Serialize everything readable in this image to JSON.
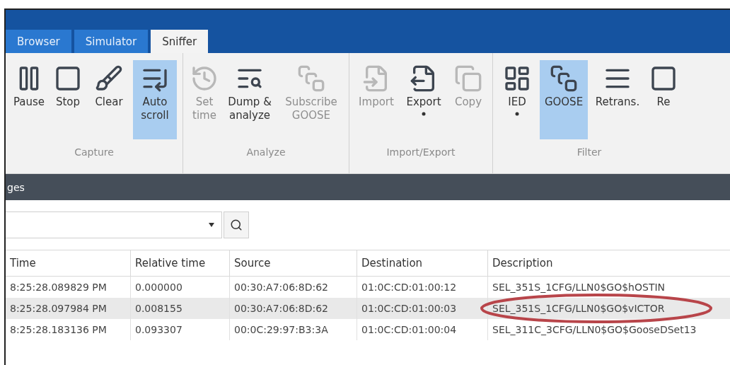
{
  "tabs": [
    {
      "label": "Browser",
      "selected": false
    },
    {
      "label": "Simulator",
      "selected": false
    },
    {
      "label": "Sniffer",
      "selected": true
    }
  ],
  "ribbon": [
    {
      "label": "Capture",
      "buttons": [
        {
          "label": "Pause",
          "disabled": false,
          "selected": false,
          "dropdown": false
        },
        {
          "label": "Stop",
          "disabled": false,
          "selected": false,
          "dropdown": false
        },
        {
          "label": "Clear",
          "disabled": false,
          "selected": false,
          "dropdown": false
        },
        {
          "label": "Auto\nscroll",
          "disabled": false,
          "selected": true,
          "dropdown": false
        }
      ]
    },
    {
      "label": "Analyze",
      "buttons": [
        {
          "label": "Set\ntime",
          "disabled": true,
          "selected": false,
          "dropdown": false
        },
        {
          "label": "Dump &\nanalyze",
          "disabled": false,
          "selected": false,
          "dropdown": false
        },
        {
          "label": "Subscribe\nGOOSE",
          "disabled": true,
          "selected": false,
          "dropdown": false
        }
      ]
    },
    {
      "label": "Import/Export",
      "buttons": [
        {
          "label": "Import",
          "disabled": true,
          "selected": false,
          "dropdown": false
        },
        {
          "label": "Export",
          "disabled": false,
          "selected": false,
          "dropdown": true
        },
        {
          "label": "Copy",
          "disabled": true,
          "selected": false,
          "dropdown": false
        }
      ]
    },
    {
      "label": "Filter",
      "buttons": [
        {
          "label": "IED",
          "disabled": false,
          "selected": false,
          "dropdown": true
        },
        {
          "label": "GOOSE",
          "disabled": false,
          "selected": true,
          "dropdown": false
        },
        {
          "label": "Retrans.",
          "disabled": false,
          "selected": false,
          "dropdown": false
        },
        {
          "label": "Re",
          "disabled": false,
          "selected": false,
          "dropdown": false
        }
      ]
    }
  ],
  "panel": {
    "title": "ges"
  },
  "table": {
    "columns": [
      "Time",
      "Relative time",
      "Source",
      "Destination",
      "Description"
    ],
    "rows": [
      {
        "cells": [
          "8:25:28.089829 PM",
          "0.000000",
          "00:30:A7:06:8D:62",
          "01:0C:CD:01:00:12",
          "SEL_351S_1CFG/LLN0$GO$hOSTIN"
        ],
        "selected": false,
        "circled": false
      },
      {
        "cells": [
          "8:25:28.097984 PM",
          "0.008155",
          "00:30:A7:06:8D:62",
          "01:0C:CD:01:00:03",
          "SEL_351S_1CFG/LLN0$GO$vICTOR"
        ],
        "selected": true,
        "circled": true
      },
      {
        "cells": [
          "8:25:28.183136 PM",
          "0.093307",
          "00:0C:29:97:B3:3A",
          "01:0C:CD:01:00:04",
          "SEL_311C_3CFG/LLN0$GO$GooseDSet13"
        ],
        "selected": false,
        "circled": false
      }
    ]
  }
}
